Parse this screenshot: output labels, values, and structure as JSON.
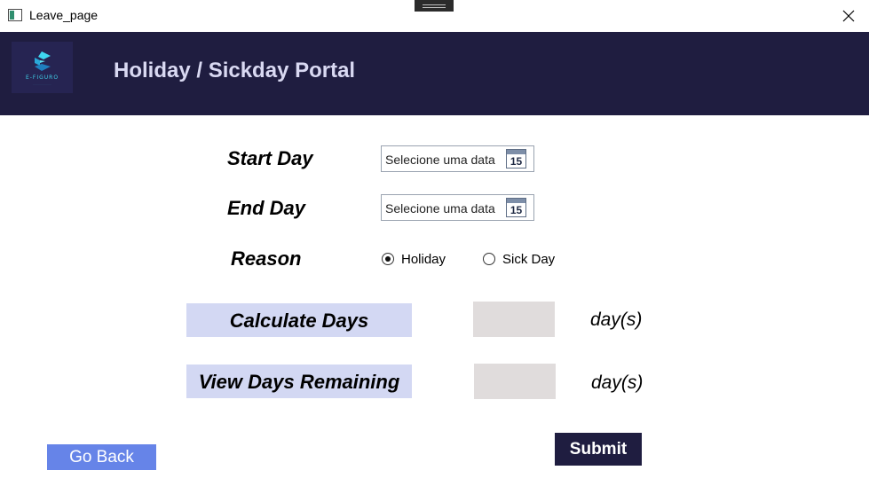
{
  "window": {
    "title": "Leave_page"
  },
  "header": {
    "logo_text": "E-FIGURO",
    "title": "Holiday / Sickday Portal"
  },
  "form": {
    "start_day": {
      "label": "Start Day",
      "placeholder": "Selecione uma data",
      "calendar_day": "15"
    },
    "end_day": {
      "label": "End Day",
      "placeholder": "Selecione uma data",
      "calendar_day": "15"
    },
    "reason": {
      "label": "Reason",
      "options": [
        {
          "label": "Holiday",
          "selected": true
        },
        {
          "label": "Sick Day",
          "selected": false
        }
      ]
    },
    "calculate": {
      "button_label": "Calculate Days",
      "value": "",
      "unit": "day(s)"
    },
    "remaining": {
      "button_label": "View Days Remaining",
      "value": "",
      "unit": "day(s)"
    }
  },
  "footer": {
    "go_back_label": "Go Back",
    "submit_label": "Submit"
  },
  "colors": {
    "header_bg": "#1f1d40",
    "title_text": "#d9d9f2",
    "action_button_bg": "#d3d8f3",
    "result_box_bg": "#e0dcdc",
    "go_back_bg": "#6684e8",
    "submit_bg": "#1f1d40"
  }
}
